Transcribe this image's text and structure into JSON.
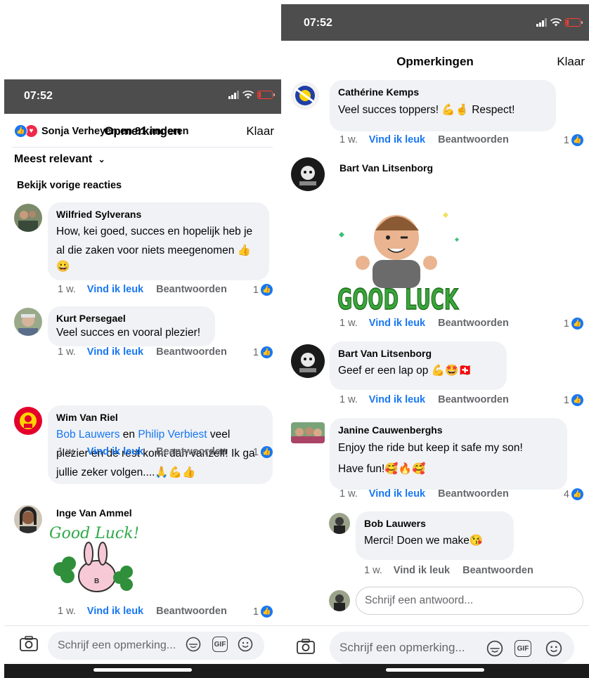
{
  "status": {
    "time": "07:52"
  },
  "header": {
    "title": "Opmerkingen",
    "done": "Klaar"
  },
  "reactions_summary": "Sonja Verheyen en 81 anderen",
  "sort_label": "Meest relevant",
  "previous_label": "Bekijk vorige reacties",
  "actions": {
    "like": "Vind ik leuk",
    "reply": "Beantwoorden"
  },
  "composer": {
    "placeholder": "Schrijf een opmerking...",
    "gif": "GIF"
  },
  "left_comments": [
    {
      "name": "Wilfried Sylverans",
      "line1": "How, kei goed, succes en hopelijk heb je",
      "line2": "al die zaken voor niets meegenomen 👍",
      "line3": "😀",
      "age": "1 w.",
      "likes": "1"
    },
    {
      "name": "Kurt Persegael",
      "text": "Veel succes en vooral plezier!",
      "age": "1 w.",
      "likes": "1"
    },
    {
      "name": "Wim Van Riel",
      "tag1": "Bob Lauwers",
      "conj": " en ",
      "tag2": "Philip Verbiest",
      "rest1": " veel",
      "line2": "plezier en de rest komt dan vanzelf! Ik ga",
      "line3": "jullie zeker volgen....🙏💪👍",
      "age": "1 w.",
      "likes": "1"
    },
    {
      "name": "Inge Van Ammel",
      "sticker_text": "Good Luck!",
      "sticker_b": "B",
      "age": "1 w.",
      "likes": "1"
    }
  ],
  "right_comments": [
    {
      "name": "Cathérine Kemps",
      "text": "Veel succes toppers! 💪🤞 Respect!",
      "age": "1 w.",
      "likes": "1"
    },
    {
      "name": "Bart Van Litsenborg",
      "sticker_text": "GOOD LUCK",
      "age": "1 w.",
      "likes": "1"
    },
    {
      "name": "Bart Van Litsenborg",
      "text": "Geef er een lap op 💪🤩🇨🇭",
      "age": "1 w.",
      "likes": "1"
    },
    {
      "name": "Janine Cauwenberghs",
      "line1": "Enjoy the ride but keep it safe my son!",
      "line2": "Have fun!🥰🔥🥰",
      "age": "1 w.",
      "likes": "4"
    }
  ],
  "reply": {
    "name": "Bob Lauwers",
    "text": "Merci! Doen we make😘",
    "age": "1 w."
  },
  "reply_placeholder": "Schrijf een antwoord...",
  "colors": {
    "link": "#1877f2",
    "bubble": "#f0f2f5",
    "status_bar": "#4d4d4d"
  }
}
